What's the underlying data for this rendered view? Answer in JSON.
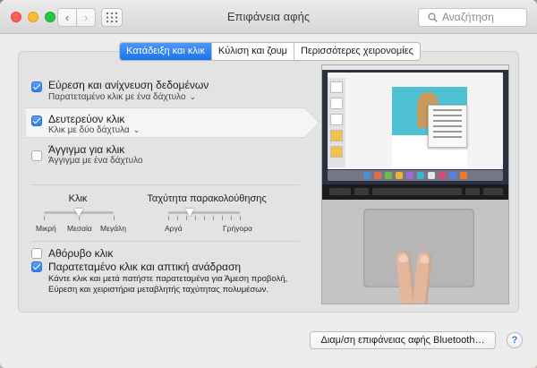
{
  "window": {
    "title": "Επιφάνεια αφής",
    "search_placeholder": "Αναζήτηση",
    "nav_back": "‹",
    "nav_forward": "›"
  },
  "tabs": [
    {
      "label": "Κατάδειξη και κλικ",
      "active": true
    },
    {
      "label": "Κύλιση και ζουμ",
      "active": false
    },
    {
      "label": "Περισσότερες χειρονομίες",
      "active": false
    }
  ],
  "options": {
    "lookup": {
      "label": "Εύρεση και ανίχνευση δεδομένων",
      "sub": "Παρατεταμένο κλικ με ένα δάχτυλο",
      "checked": true
    },
    "secondary": {
      "label": "Δευτερεύον κλικ",
      "sub": "Κλικ με δύο δάχτυλα",
      "checked": true
    },
    "tap": {
      "label": "Άγγιγμα για κλικ",
      "sub": "Άγγιγμα με ένα δάχτυλο",
      "checked": false
    }
  },
  "sliders": {
    "click": {
      "title": "Κλικ",
      "ticks": [
        "Μικρή",
        "Μεσαία",
        "Μεγάλη"
      ],
      "value": 0.5
    },
    "tracking": {
      "title": "Ταχύτητα παρακολούθησης",
      "ticks": [
        "Αργά",
        "Γρήγορα"
      ],
      "value": 0.3
    }
  },
  "bottom": {
    "silent": {
      "label": "Αθόρυβο κλικ",
      "checked": false
    },
    "force": {
      "label": "Παρατεταμένο κλικ και απτική ανάδραση",
      "checked": true,
      "description": "Κάντε κλικ και μετά πατήστε παρατεταμένα για Άμεση προβολή, Εύρεση και χειριστήρια μεταβλητής ταχύτητας πολυμέσων."
    }
  },
  "footer": {
    "bluetooth_button": "Διαμ/ση επιφάνειας αφής Bluetooth…",
    "help": "?"
  },
  "colors": {
    "accent": "#1a74ee",
    "close": "#fc5f57",
    "minimize": "#fdbc2e",
    "maximize": "#28c840"
  }
}
